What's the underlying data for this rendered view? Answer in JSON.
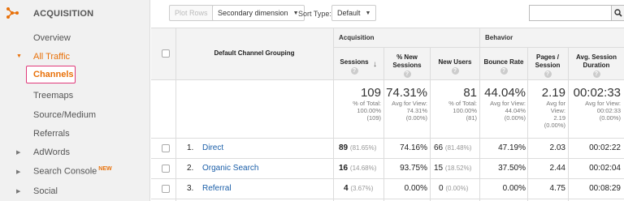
{
  "sidebar": {
    "section_title": "ACQUISITION",
    "items": [
      {
        "label": "Overview"
      },
      {
        "label": "All Traffic",
        "arrow": "▼"
      },
      {
        "label": "Channels"
      },
      {
        "label": "Treemaps"
      },
      {
        "label": "Source/Medium"
      },
      {
        "label": "Referrals"
      },
      {
        "label": "AdWords",
        "arrow": "▶"
      },
      {
        "label": "Search Console",
        "arrow": "▶",
        "badge": "NEW"
      },
      {
        "label": "Social",
        "arrow": "▶"
      }
    ],
    "accent_color": "#e8710a"
  },
  "toolbar": {
    "plot_rows": "Plot Rows",
    "secondary_dimension": "Secondary dimension",
    "sort_type_label": "Sort Type:",
    "sort_type_value": "Default",
    "search_value": ""
  },
  "table": {
    "group_acquisition": "Acquisition",
    "group_behavior": "Behavior",
    "dimension_header": "Default Channel Grouping",
    "columns": [
      {
        "label": "Sessions"
      },
      {
        "label": "% New Sessions"
      },
      {
        "label": "New Users"
      },
      {
        "label": "Bounce Rate"
      },
      {
        "label": "Pages / Session"
      },
      {
        "label": "Avg. Session Duration"
      }
    ],
    "help_glyph": "?",
    "totals": [
      {
        "value": "109",
        "sub1": "% of Total:",
        "sub2": "100.00%",
        "sub3": "(109)"
      },
      {
        "value": "74.31%",
        "sub1": "Avg for View:",
        "sub2": "74.31%",
        "sub3": "(0.00%)"
      },
      {
        "value": "81",
        "sub1": "% of Total:",
        "sub2": "100.00%",
        "sub3": "(81)"
      },
      {
        "value": "44.04%",
        "sub1": "Avg for View:",
        "sub2": "44.04%",
        "sub3": "(0.00%)"
      },
      {
        "value": "2.19",
        "sub1": "Avg for",
        "sub2": "View:",
        "sub3": "2.19",
        "sub4": "(0.00%)"
      },
      {
        "value": "00:02:33",
        "sub1": "Avg for View:",
        "sub2": "00:02:33",
        "sub3": "(0.00%)"
      }
    ],
    "rows": [
      {
        "index": "1.",
        "channel": "Direct",
        "sessions": "89",
        "sessions_pct": "(81.65%)",
        "new_sessions": "74.16%",
        "new_users": "66",
        "new_users_pct": "(81.48%)",
        "bounce": "47.19%",
        "pages": "2.03",
        "duration": "00:02:22"
      },
      {
        "index": "2.",
        "channel": "Organic Search",
        "sessions": "16",
        "sessions_pct": "(14.68%)",
        "new_sessions": "93.75%",
        "new_users": "15",
        "new_users_pct": "(18.52%)",
        "bounce": "37.50%",
        "pages": "2.44",
        "duration": "00:02:04"
      },
      {
        "index": "3.",
        "channel": "Referral",
        "sessions": "4",
        "sessions_pct": "(3.67%)",
        "new_sessions": "0.00%",
        "new_users": "0",
        "new_users_pct": "(0.00%)",
        "bounce": "0.00%",
        "pages": "4.75",
        "duration": "00:08:29"
      }
    ]
  }
}
